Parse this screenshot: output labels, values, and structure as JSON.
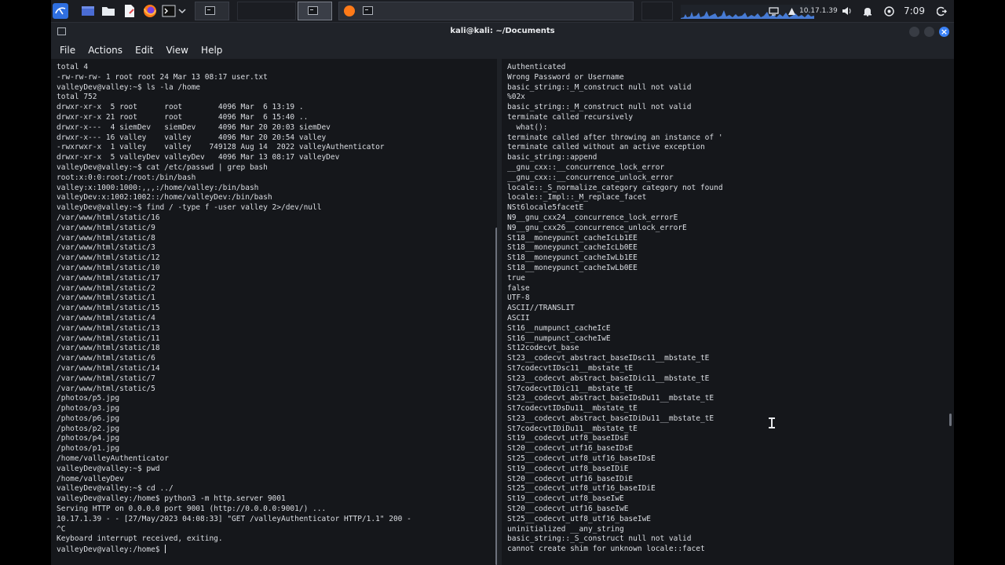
{
  "window": {
    "title": "kali@kali: ~/Documents"
  },
  "menu": [
    "File",
    "Actions",
    "Edit",
    "View",
    "Help"
  ],
  "tray": {
    "ip": "10.17.1.39",
    "time": "7:09"
  },
  "icons": {
    "kali": "kali-menu-icon",
    "workspace": "workspace-icon",
    "files": "file-manager-icon",
    "editor": "text-editor-icon",
    "firefox": "firefox-icon",
    "terminal": "terminal-icon"
  },
  "colors": {
    "accent": "#3b82f6",
    "background": "#15171b",
    "text": "#dcdfe4"
  },
  "left_terminal": {
    "lines": [
      "total 4",
      "-rw-rw-rw- 1 root root 24 Mar 13 08:17 user.txt",
      "valleyDev@valley:~$ ls -la /home",
      "total 752",
      "drwxr-xr-x  5 root      root        4096 Mar  6 13:19 .",
      "drwxr-xr-x 21 root      root        4096 Mar  6 15:40 ..",
      "drwxr-x---  4 siemDev   siemDev     4096 Mar 20 20:03 siemDev",
      "drwxr-x--- 16 valley    valley      4096 Mar 20 20:54 valley",
      "-rwxrwxr-x  1 valley    valley    749128 Aug 14  2022 valleyAuthenticator",
      "drwxr-xr-x  5 valleyDev valleyDev   4096 Mar 13 08:17 valleyDev",
      "valleyDev@valley:~$ cat /etc/passwd | grep bash",
      "root:x:0:0:root:/root:/bin/bash",
      "valley:x:1000:1000:,,,:/home/valley:/bin/bash",
      "valleyDev:x:1002:1002::/home/valleyDev:/bin/bash",
      "valleyDev@valley:~$ find / -type f -user valley 2>/dev/null",
      "/var/www/html/static/16",
      "/var/www/html/static/9",
      "/var/www/html/static/8",
      "/var/www/html/static/3",
      "/var/www/html/static/12",
      "/var/www/html/static/10",
      "/var/www/html/static/17",
      "/var/www/html/static/2",
      "/var/www/html/static/1",
      "/var/www/html/static/15",
      "/var/www/html/static/4",
      "/var/www/html/static/13",
      "/var/www/html/static/11",
      "/var/www/html/static/18",
      "/var/www/html/static/6",
      "/var/www/html/static/14",
      "/var/www/html/static/7",
      "/var/www/html/static/5",
      "/photos/p5.jpg",
      "/photos/p3.jpg",
      "/photos/p6.jpg",
      "/photos/p2.jpg",
      "/photos/p4.jpg",
      "/photos/p1.jpg",
      "/home/valleyAuthenticator",
      "valleyDev@valley:~$ pwd",
      "/home/valleyDev",
      "valleyDev@valley:~$ cd ../",
      "valleyDev@valley:/home$ python3 -m http.server 9001",
      "Serving HTTP on 0.0.0.0 port 9001 (http://0.0.0.0:9001/) ...",
      "10.17.1.39 - - [27/May/2023 04:08:33] \"GET /valleyAuthenticator HTTP/1.1\" 200 -",
      "^C",
      "Keyboard interrupt received, exiting.",
      "valleyDev@valley:/home$ "
    ]
  },
  "right_terminal": {
    "lines": [
      "Authenticated",
      "Wrong Password or Username",
      "basic_string::_M_construct null not valid",
      "%02x",
      "basic_string::_M_construct null not valid",
      "terminate called recursively",
      "  what():",
      "terminate called after throwing an instance of '",
      "terminate called without an active exception",
      "basic_string::append",
      "__gnu_cxx::__concurrence_lock_error",
      "__gnu_cxx::__concurrence_unlock_error",
      "locale::_S_normalize_category category not found",
      "locale::_Impl::_M_replace_facet",
      "NSt6locale5facetE",
      "N9__gnu_cxx24__concurrence_lock_errorE",
      "N9__gnu_cxx26__concurrence_unlock_errorE",
      "St18__moneypunct_cacheIcLb1EE",
      "St18__moneypunct_cacheIcLb0EE",
      "St18__moneypunct_cacheIwLb1EE",
      "St18__moneypunct_cacheIwLb0EE",
      "true",
      "false",
      "UTF-8",
      "ASCII//TRANSLIT",
      "ASCII",
      "St16__numpunct_cacheIcE",
      "St16__numpunct_cacheIwE",
      "St12codecvt_base",
      "St23__codecvt_abstract_baseIDsc11__mbstate_tE",
      "St7codecvtIDsc11__mbstate_tE",
      "St23__codecvt_abstract_baseIDic11__mbstate_tE",
      "St7codecvtIDic11__mbstate_tE",
      "St23__codecvt_abstract_baseIDsDu11__mbstate_tE",
      "St7codecvtIDsDu11__mbstate_tE",
      "St23__codecvt_abstract_baseIDiDu11__mbstate_tE",
      "St7codecvtIDiDu11__mbstate_tE",
      "St19__codecvt_utf8_baseIDsE",
      "St20__codecvt_utf16_baseIDsE",
      "St25__codecvt_utf8_utf16_baseIDsE",
      "St19__codecvt_utf8_baseIDiE",
      "St20__codecvt_utf16_baseIDiE",
      "St25__codecvt_utf8_utf16_baseIDiE",
      "St19__codecvt_utf8_baseIwE",
      "St20__codecvt_utf16_baseIwE",
      "St25__codecvt_utf8_utf16_baseIwE",
      "uninitialized __any_string",
      "basic_string::_S_construct null not valid",
      "cannot create shim for unknown locale::facet"
    ]
  }
}
